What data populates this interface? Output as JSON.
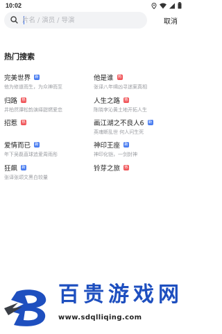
{
  "status_bar": {
    "time": "10:02"
  },
  "search": {
    "placeholder": "片名 / 演员 / 导演",
    "value": "",
    "cancel_label": "取消"
  },
  "hot_search": {
    "title": "热门搜索",
    "items": [
      {
        "title": "完美世界",
        "badge": "新",
        "badge_type": "new",
        "desc": "他为修道而生，为众神而至"
      },
      {
        "title": "他是谁",
        "badge": "热",
        "badge_type": "hot",
        "desc": "张译八年缉凶寻迷案真相"
      },
      {
        "title": "归路",
        "badge": "热",
        "badge_type": "hot",
        "desc": "井柏然谭松韵演绎甜燃爱恋"
      },
      {
        "title": "人生之路",
        "badge": "热",
        "badge_type": "hot",
        "desc": "陈晓李沁黄土地开拓人生"
      },
      {
        "title": "招惹",
        "badge": "热",
        "badge_type": "hot",
        "desc": ""
      },
      {
        "title": "画江湖之不良人6",
        "badge": "新",
        "badge_type": "new",
        "desc": "英魂断乱世 何人问生死"
      },
      {
        "title": "爱情而已",
        "badge": "新",
        "badge_type": "new",
        "desc": "年下吴磊直球追爱周雨彤"
      },
      {
        "title": "神印王座",
        "badge": "新",
        "badge_type": "new",
        "desc": "神印化铠，一剑封神"
      },
      {
        "title": "狂飙",
        "badge": "新",
        "badge_type": "new",
        "desc": "张译张颂文黑白较量"
      },
      {
        "title": "铃芽之旅",
        "badge": "热",
        "badge_type": "hot",
        "desc": ""
      }
    ]
  },
  "watermark": {
    "name_chars": [
      "百",
      "贵",
      "游",
      "戏",
      "网"
    ],
    "url": "www.sdqlliqing.com"
  },
  "colors": {
    "hot_badge": "#f0565a",
    "new_badge": "#4a7df0",
    "watermark_blue": "#1e4fbf"
  }
}
